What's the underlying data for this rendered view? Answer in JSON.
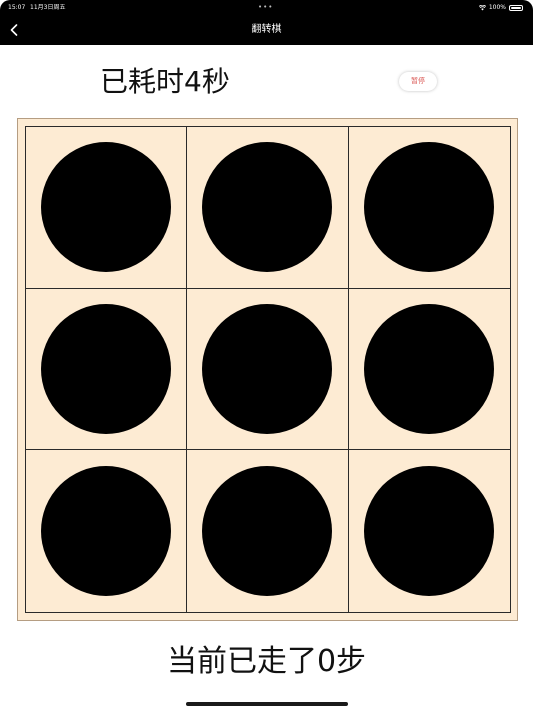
{
  "status_bar": {
    "time": "15:07",
    "date": "11月3日周五",
    "dots": "•••",
    "battery_text": "100%"
  },
  "nav": {
    "title": "翻转棋",
    "back_icon": "chevron-left-icon"
  },
  "timer": {
    "text": "已耗时4秒"
  },
  "pause_button": {
    "label": "暂停"
  },
  "board": {
    "rows": 3,
    "cols": 3,
    "pieces": [
      [
        "black",
        "black",
        "black"
      ],
      [
        "black",
        "black",
        "black"
      ],
      [
        "black",
        "black",
        "black"
      ]
    ]
  },
  "steps": {
    "text": "当前已走了0步"
  },
  "colors": {
    "board_background": "#fdebd3",
    "piece_black": "#000000",
    "pause_text": "#d9534f",
    "topbar": "#000000"
  }
}
